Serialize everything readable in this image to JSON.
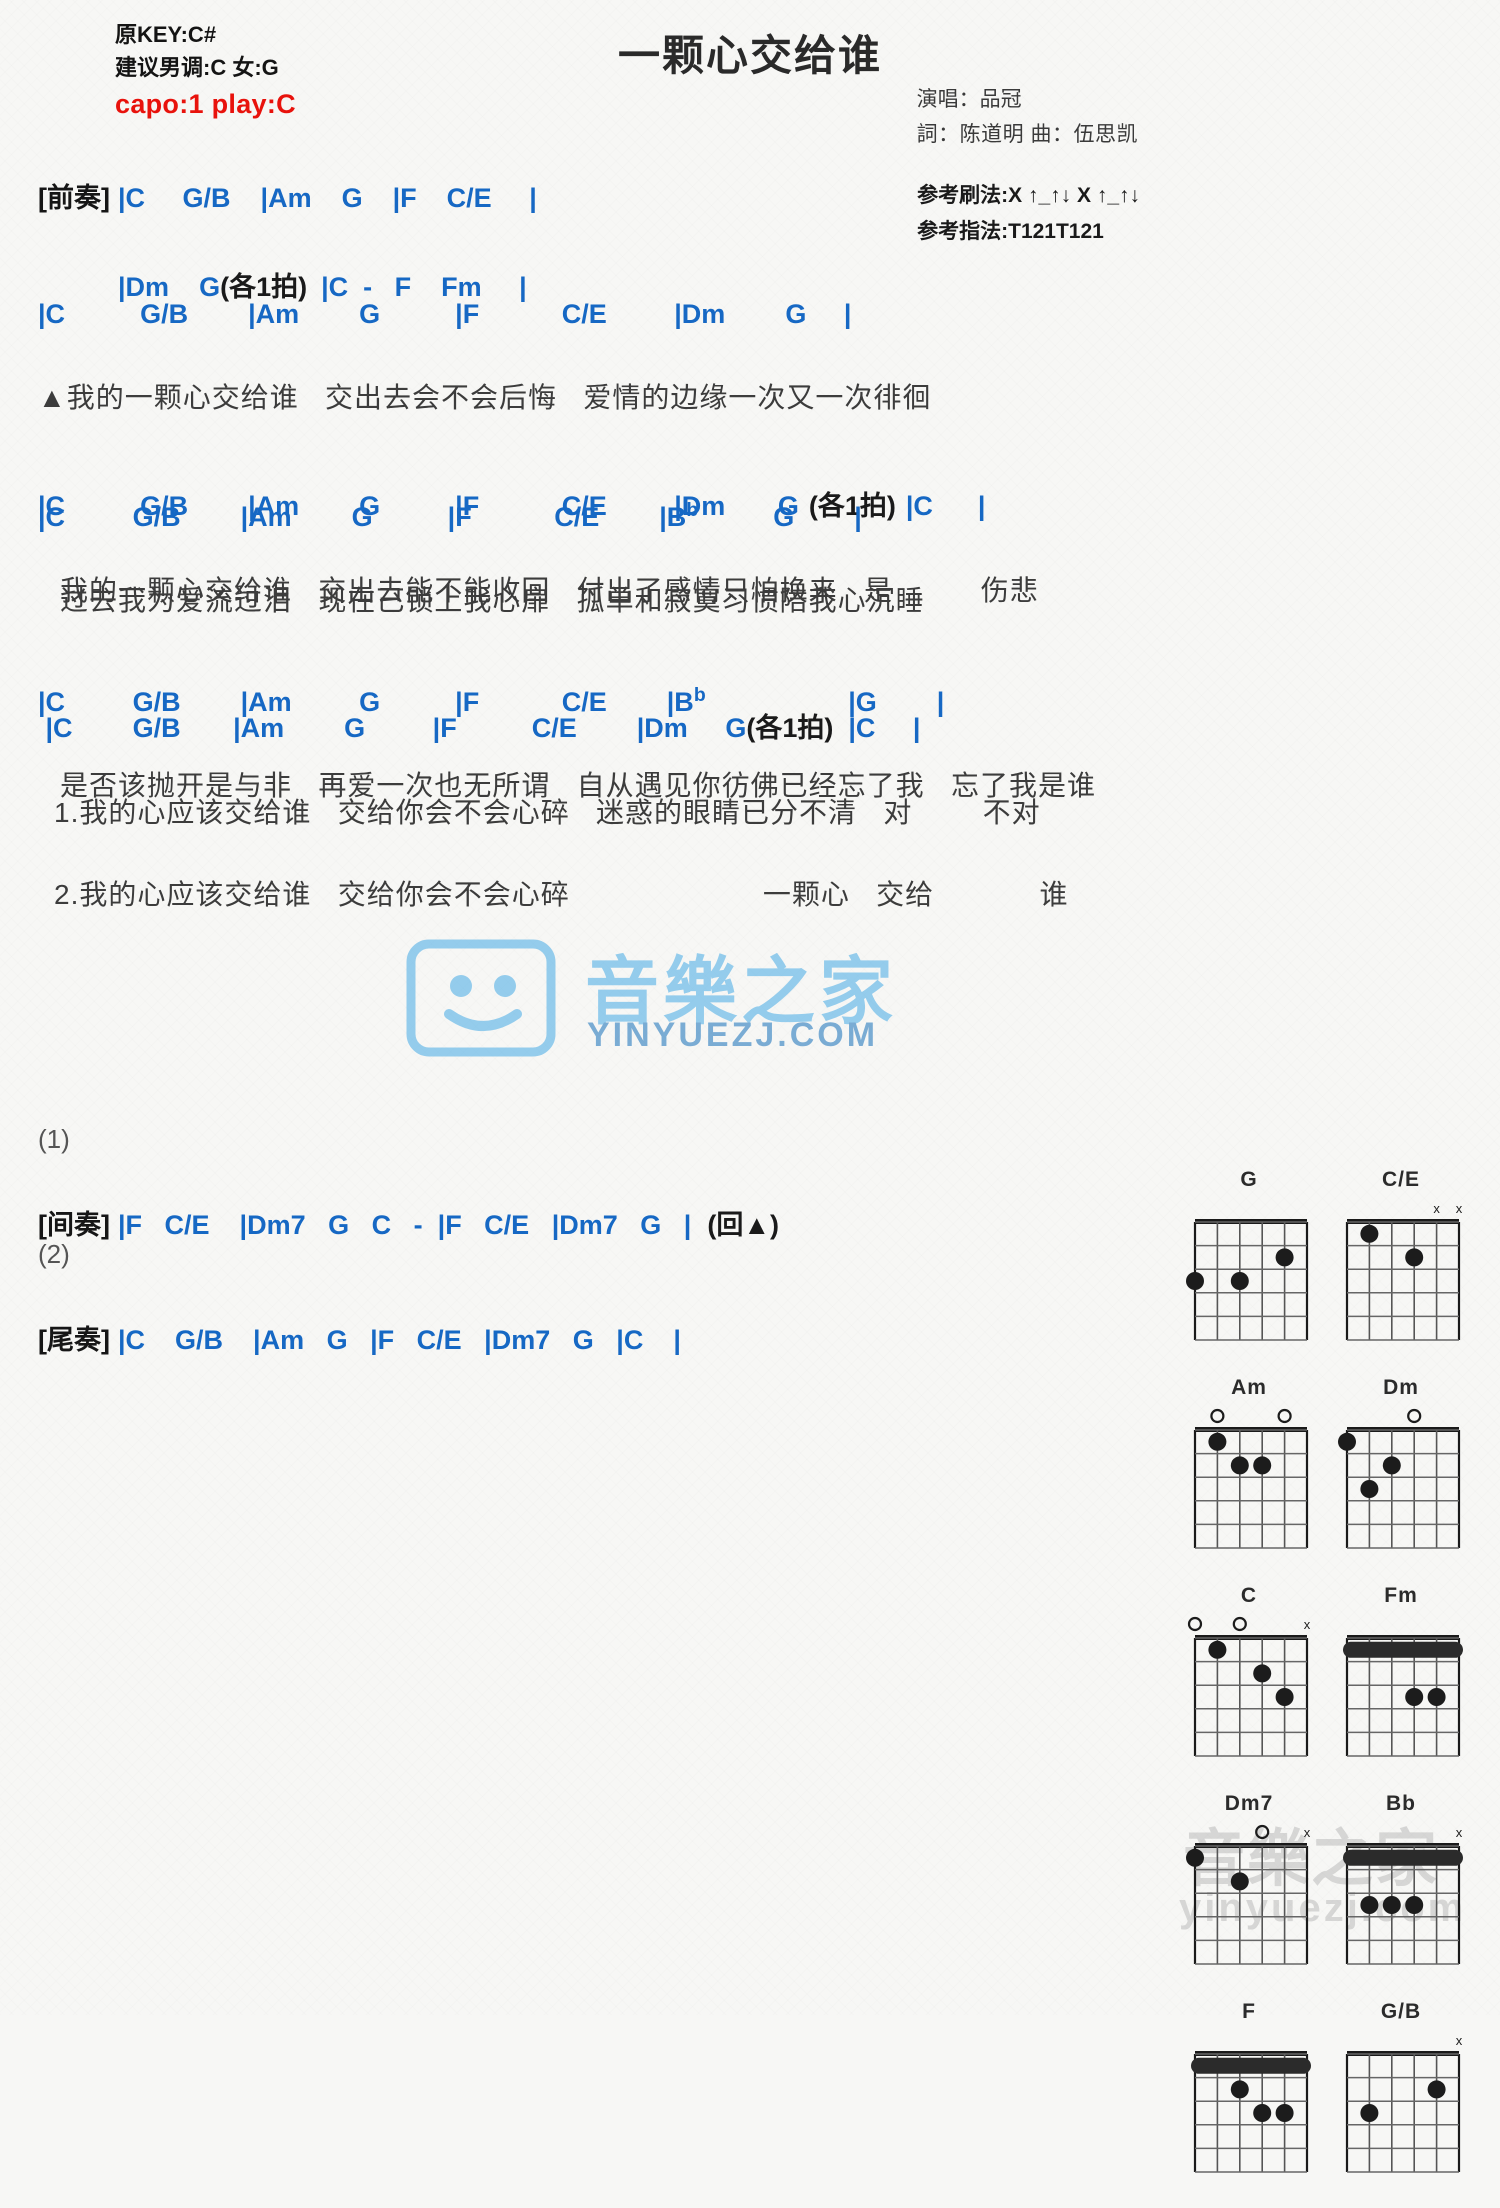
{
  "header": {
    "orig_key": "原KEY:C#",
    "suggest_key": "建议男调:C 女:G",
    "capo": "capo:1 play:C",
    "title": "一颗心交给谁",
    "singer": "演唱：品冠",
    "writers": "詞：陈道明  曲：伍思凯",
    "strum_ref": "参考刷法:X ↑_↑↓ X ↑_↑↓",
    "finger_ref": "参考指法:T121T121",
    "capo_color": "#e8120c",
    "chord_color": "#1668c4"
  },
  "sections": {
    "intro": {
      "tag": "[前奏]",
      "line1_chords": "|C     G/B    |Am    G    |F    C/E     |",
      "line2_chords": "|Dm    G",
      "line2_note": "(各1拍)",
      "line2_chords_b": "|C  -   F    Fm     |"
    },
    "verse1": {
      "l1_chords": "|C          G/B        |Am        G          |F           C/E         |Dm        G     |",
      "l1_lyrics": "▲我的一颗心交给谁   交出去会不会后悔   爱情的边缘一次又一次徘徊",
      "l2_chords_a": "|C          G/B        |Am        G          |F           C/E         |Dm       G",
      "l2_note": "(各1拍)",
      "l2_chords_b": "|C      |",
      "l2_lyrics": "我的一颗心交给谁   交出去能不能收回   付出了感情只怕换来   是          伤悲"
    },
    "verse2": {
      "l1_chords_pre": "|C         G/B        |Am        G          |F           C/E        |B",
      "l1_flat": "b",
      "l1_chords_post": "          G        |",
      "l1_lyrics": "过去我为爱流过泪   现在己锁上我心扉   孤单和寂寞习惯陪我心沉睡",
      "l2_chords_pre": "|C         G/B        |Am         G          |F           C/E        |B",
      "l2_flat": "b",
      "l2_chords_post": "                   |G        |",
      "l2_lyrics": "是否该抛开是与非   再爱一次也无所谓   自从遇见你彷佛已经忘了我   忘了我是谁"
    },
    "chorus": {
      "chords_a": " |C        G/B       |Am        G         |F          C/E        |Dm     G",
      "note": "(各1拍)",
      "chords_b": "  |C     |",
      "line1": "1.我的心应该交给谁   交给你会不会心碎   迷惑的眼睛已分不清   对        不对",
      "line2": "2.我的心应该交给谁   交给你会不会心碎                      一颗心   交给            谁"
    },
    "interlude": {
      "num": "(1)",
      "tag": "[间奏]",
      "chords": "|F   C/E    |Dm7   G   C   -  |F   C/E   |Dm7   G   |",
      "repeat": "(回▲)"
    },
    "outro": {
      "num": "(2)",
      "tag": "[尾奏]",
      "chords": "|C    G/B    |Am   G   |F   C/E   |Dm7   G   |C    |"
    }
  },
  "watermark": {
    "main": "音樂之家",
    "sub": "YINYUEZJ.COM",
    "secondary_a": "音樂之家",
    "secondary_b": "yinyuezj.com"
  },
  "chord_diagrams": [
    [
      {
        "name": "G",
        "markers": "..o..",
        "frets": 5,
        "barre": null,
        "dots": [
          [
            5,
            2
          ],
          [
            3,
            3
          ],
          [
            1,
            3
          ]
        ],
        "open": [],
        "muted": []
      },
      {
        "name": "C/E",
        "markers": "xx...",
        "frets": 5,
        "barre": null,
        "dots": [
          [
            2,
            1
          ],
          [
            4,
            2
          ]
        ],
        "open": [],
        "muted": [
          6,
          5
        ]
      }
    ],
    [
      {
        "name": "Am",
        "markers": "x.oo.",
        "frets": 5,
        "barre": null,
        "dots": [
          [
            2,
            1
          ],
          [
            4,
            2
          ],
          [
            3,
            2
          ]
        ],
        "open": [
          5,
          2
        ],
        "muted": []
      },
      {
        "name": "Dm",
        "markers": "xxo...",
        "frets": 5,
        "barre": null,
        "dots": [
          [
            1,
            1
          ],
          [
            3,
            2
          ],
          [
            2,
            3
          ]
        ],
        "open": [
          4
        ],
        "muted": []
      }
    ],
    [
      {
        "name": "C",
        "markers": "x.oo.",
        "frets": 5,
        "barre": null,
        "dots": [
          [
            2,
            1
          ],
          [
            4,
            2
          ],
          [
            5,
            3
          ]
        ],
        "open": [
          3,
          1
        ],
        "muted": [
          6
        ]
      },
      {
        "name": "Fm",
        "markers": ".....",
        "frets": 5,
        "barre": 1,
        "dots": [
          [
            5,
            3
          ],
          [
            4,
            3
          ]
        ],
        "open": [],
        "muted": []
      }
    ],
    [
      {
        "name": "Dm7",
        "markers": "x.o..",
        "frets": 5,
        "barre": null,
        "dots": [
          [
            1,
            1
          ],
          [
            3,
            2
          ]
        ],
        "open": [
          4
        ],
        "muted": [
          6
        ]
      },
      {
        "name": "Bb",
        "markers": "x....",
        "frets": 5,
        "barre": 1,
        "dots": [
          [
            4,
            3
          ],
          [
            3,
            3
          ],
          [
            2,
            3
          ]
        ],
        "open": [],
        "muted": [
          6
        ]
      }
    ],
    [
      {
        "name": "F",
        "markers": ".....",
        "frets": 5,
        "barre": 1,
        "dots": [
          [
            3,
            2
          ],
          [
            5,
            3
          ],
          [
            4,
            3
          ]
        ],
        "open": [],
        "muted": []
      },
      {
        "name": "G/B",
        "markers": "x....",
        "frets": 5,
        "barre": null,
        "dots": [
          [
            5,
            2
          ],
          [
            2,
            3
          ]
        ],
        "open": [],
        "muted": [
          6
        ]
      }
    ]
  ]
}
